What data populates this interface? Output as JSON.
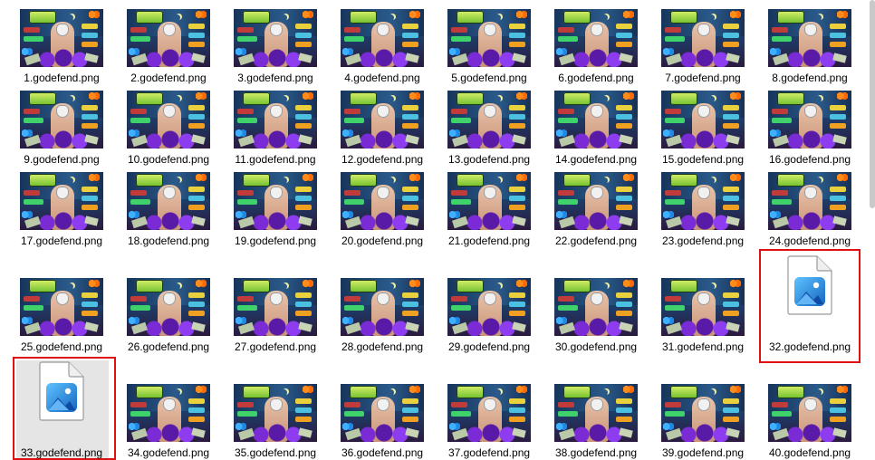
{
  "files": [
    {
      "name": "1.godefend.png",
      "kind": "thumbnail"
    },
    {
      "name": "2.godefend.png",
      "kind": "thumbnail"
    },
    {
      "name": "3.godefend.png",
      "kind": "thumbnail"
    },
    {
      "name": "4.godefend.png",
      "kind": "thumbnail"
    },
    {
      "name": "5.godefend.png",
      "kind": "thumbnail"
    },
    {
      "name": "6.godefend.png",
      "kind": "thumbnail"
    },
    {
      "name": "7.godefend.png",
      "kind": "thumbnail"
    },
    {
      "name": "8.godefend.png",
      "kind": "thumbnail"
    },
    {
      "name": "9.godefend.png",
      "kind": "thumbnail"
    },
    {
      "name": "10.godefend.png",
      "kind": "thumbnail"
    },
    {
      "name": "11.godefend.png",
      "kind": "thumbnail"
    },
    {
      "name": "12.godefend.png",
      "kind": "thumbnail"
    },
    {
      "name": "13.godefend.png",
      "kind": "thumbnail"
    },
    {
      "name": "14.godefend.png",
      "kind": "thumbnail"
    },
    {
      "name": "15.godefend.png",
      "kind": "thumbnail"
    },
    {
      "name": "16.godefend.png",
      "kind": "thumbnail"
    },
    {
      "name": "17.godefend.png",
      "kind": "thumbnail"
    },
    {
      "name": "18.godefend.png",
      "kind": "thumbnail"
    },
    {
      "name": "19.godefend.png",
      "kind": "thumbnail"
    },
    {
      "name": "20.godefend.png",
      "kind": "thumbnail"
    },
    {
      "name": "21.godefend.png",
      "kind": "thumbnail"
    },
    {
      "name": "22.godefend.png",
      "kind": "thumbnail"
    },
    {
      "name": "23.godefend.png",
      "kind": "thumbnail"
    },
    {
      "name": "24.godefend.png",
      "kind": "thumbnail"
    },
    {
      "name": "25.godefend.png",
      "kind": "thumbnail"
    },
    {
      "name": "26.godefend.png",
      "kind": "thumbnail"
    },
    {
      "name": "27.godefend.png",
      "kind": "thumbnail"
    },
    {
      "name": "28.godefend.png",
      "kind": "thumbnail"
    },
    {
      "name": "29.godefend.png",
      "kind": "thumbnail"
    },
    {
      "name": "30.godefend.png",
      "kind": "thumbnail"
    },
    {
      "name": "31.godefend.png",
      "kind": "thumbnail"
    },
    {
      "name": "32.godefend.png",
      "kind": "generic-icon",
      "highlighted": true
    },
    {
      "name": "33.godefend.png",
      "kind": "generic-icon",
      "highlighted": true,
      "hovered": true
    },
    {
      "name": "34.godefend.png",
      "kind": "thumbnail"
    },
    {
      "name": "35.godefend.png",
      "kind": "thumbnail"
    },
    {
      "name": "36.godefend.png",
      "kind": "thumbnail"
    },
    {
      "name": "37.godefend.png",
      "kind": "thumbnail"
    },
    {
      "name": "38.godefend.png",
      "kind": "thumbnail"
    },
    {
      "name": "39.godefend.png",
      "kind": "thumbnail"
    },
    {
      "name": "40.godefend.png",
      "kind": "thumbnail"
    }
  ],
  "icons": {
    "thumbnail": "image-thumbnail-icon",
    "generic": "photos-file-icon"
  },
  "colors": {
    "highlight_border": "#e01010",
    "hover_background": "#e5e5e5",
    "photos_icon_accent": "#1e88e5"
  }
}
